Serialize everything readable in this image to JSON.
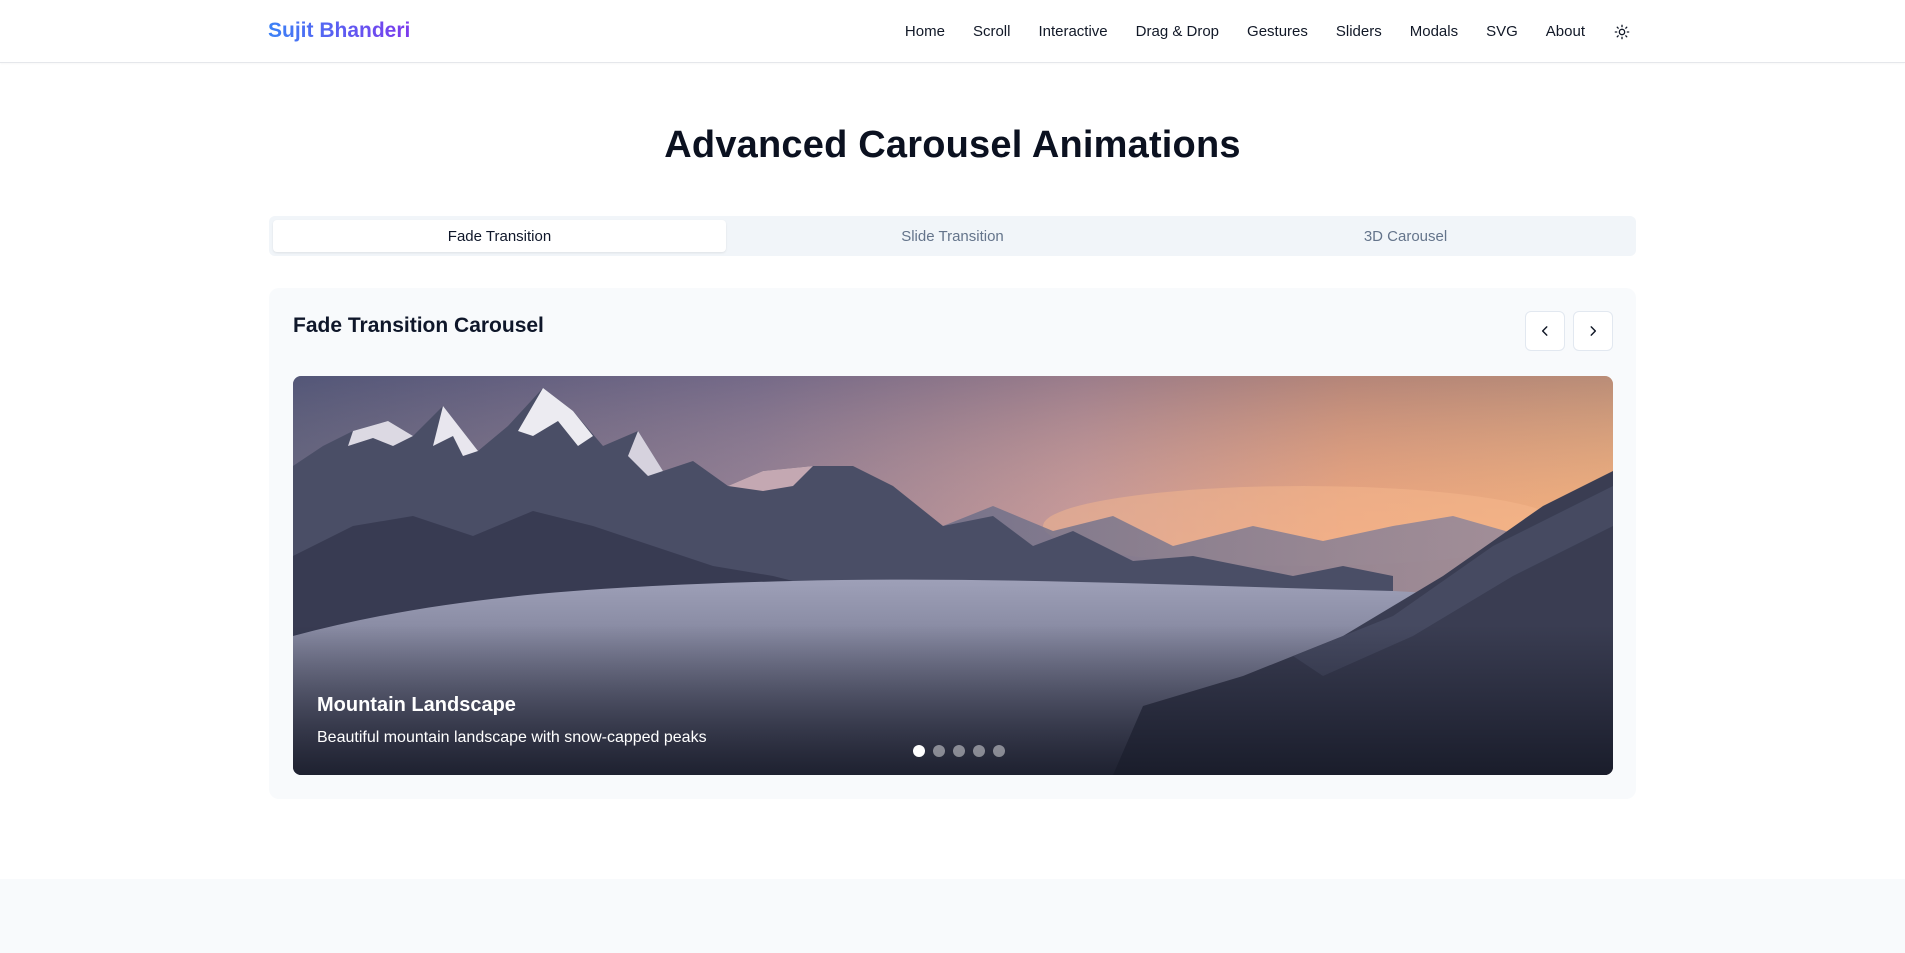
{
  "header": {
    "brand": "Sujit Bhanderi",
    "nav": [
      {
        "label": "Home"
      },
      {
        "label": "Scroll"
      },
      {
        "label": "Interactive"
      },
      {
        "label": "Drag & Drop"
      },
      {
        "label": "Gestures"
      },
      {
        "label": "Sliders"
      },
      {
        "label": "Modals"
      },
      {
        "label": "SVG"
      },
      {
        "label": "About"
      }
    ],
    "theme_icon": "sun-icon"
  },
  "page": {
    "title": "Advanced Carousel Animations"
  },
  "tabs": [
    {
      "label": "Fade Transition",
      "active": true
    },
    {
      "label": "Slide Transition",
      "active": false
    },
    {
      "label": "3D Carousel",
      "active": false
    }
  ],
  "carousel": {
    "title": "Fade Transition Carousel",
    "prev_icon": "chevron-left-icon",
    "next_icon": "chevron-right-icon",
    "slide": {
      "title": "Mountain Landscape",
      "description": "Beautiful mountain landscape with snow-capped peaks"
    },
    "dot_count": 5,
    "active_index": 0
  },
  "colors": {
    "brand_gradient_start": "#3b82f6",
    "brand_gradient_end": "#7c3aed",
    "tabs_bg": "#f1f5f9",
    "card_bg": "#f8fafc"
  }
}
